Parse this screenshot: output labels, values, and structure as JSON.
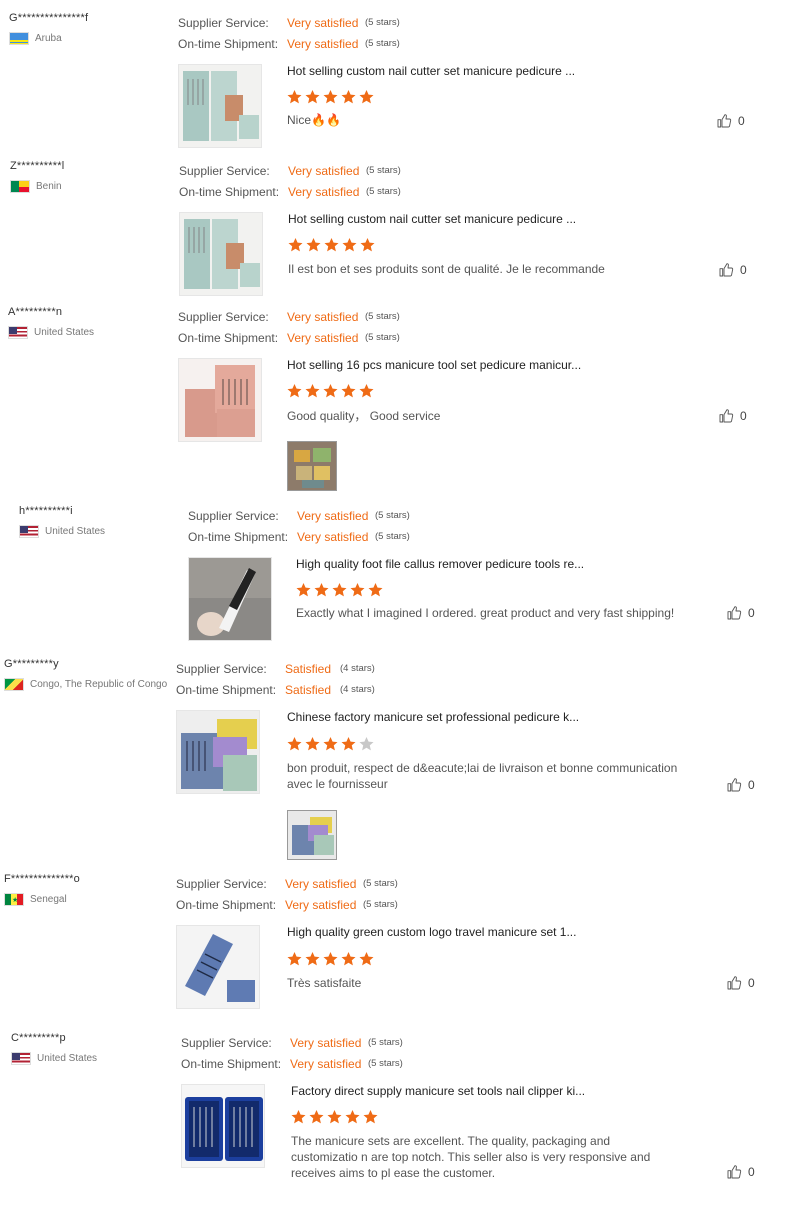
{
  "labels": {
    "supplier": "Supplier Service:",
    "shipment": "On-time Shipment:"
  },
  "colors": {
    "accent": "#ef6b16",
    "star_empty": "#c8c8c8"
  },
  "icons": {
    "like": "thumbs-up-icon",
    "star": "star-icon"
  },
  "reviews": [
    {
      "user": "G***************f",
      "country": "Aruba",
      "supplier_value": "Very satisfied",
      "supplier_stars": "(5 stars)",
      "shipment_value": "Very satisfied",
      "shipment_stars": "(5 stars)",
      "product_title": "Hot selling custom nail cutter set manicure pedicure ...",
      "rating": 5,
      "comment": "Nice🔥🔥",
      "likes": "0"
    },
    {
      "user": "Z**********l",
      "country": "Benin",
      "supplier_value": "Very satisfied",
      "supplier_stars": "(5 stars)",
      "shipment_value": "Very satisfied",
      "shipment_stars": "(5 stars)",
      "product_title": "Hot selling custom nail cutter set manicure pedicure ...",
      "rating": 5,
      "comment": "Il est bon et ses produits sont de qualité. Je le recommande",
      "likes": "0"
    },
    {
      "user": "A*********n",
      "country": "United States",
      "supplier_value": "Very satisfied",
      "supplier_stars": "(5 stars)",
      "shipment_value": "Very satisfied",
      "shipment_stars": "(5 stars)",
      "product_title": "Hot selling 16 pcs manicure tool set pedicure manicur...",
      "rating": 5,
      "comment": "Good quality，  Good service",
      "likes": "0"
    },
    {
      "user": "h**********i",
      "country": "United States",
      "supplier_value": "Very satisfied",
      "supplier_stars": "(5 stars)",
      "shipment_value": "Very satisfied",
      "shipment_stars": "(5 stars)",
      "product_title": "High quality foot file callus remover pedicure tools re...",
      "rating": 5,
      "comment": "Exactly what I imagined I ordered. great product and very fast shipping!",
      "likes": "0"
    },
    {
      "user": "G*********y",
      "country": "Congo, The Republic of Congo",
      "supplier_value": "Satisfied",
      "supplier_stars": "(4 stars)",
      "shipment_value": "Satisfied",
      "shipment_stars": "(4 stars)",
      "product_title": "Chinese factory manicure set professional pedicure k...",
      "rating": 4,
      "comment": "bon produit, respect de d&eacute;lai de livraison et bonne communication avec le fournisseur",
      "likes": "0"
    },
    {
      "user": "F**************o",
      "country": "Senegal",
      "supplier_value": "Very satisfied",
      "supplier_stars": "(5 stars)",
      "shipment_value": "Very satisfied",
      "shipment_stars": "(5 stars)",
      "product_title": "High quality green custom logo travel manicure set 1...",
      "rating": 5,
      "comment": "Très satisfaite",
      "likes": "0"
    },
    {
      "user": "C*********p",
      "country": "United States",
      "supplier_value": "Very satisfied",
      "supplier_stars": "(5 stars)",
      "shipment_value": "Very satisfied",
      "shipment_stars": "(5 stars)",
      "product_title": "Factory direct supply manicure set tools nail clipper ki...",
      "rating": 5,
      "comment": "The manicure sets are excellent. The quality, packaging and customizatio n are top notch. This seller also is very responsive and receives aims to pl ease the customer.",
      "likes": "0"
    }
  ]
}
